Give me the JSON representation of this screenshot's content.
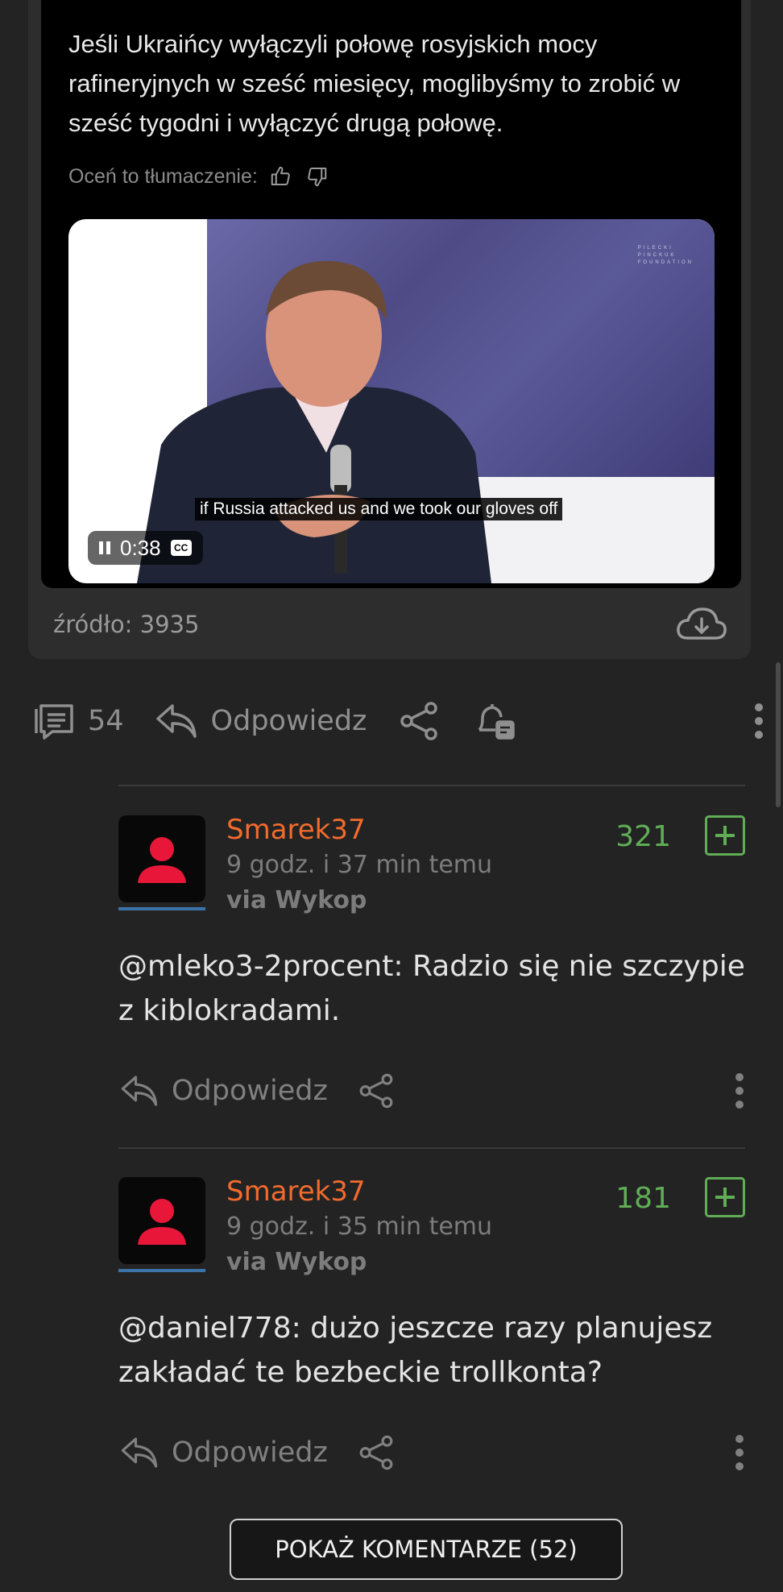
{
  "embed": {
    "tweet_text": "Jeśli Ukraińcy wyłączyli połowę rosyjskich mocy rafineryjnych w sześć miesięcy, moglibyśmy to zrobić w sześć tygodni i wyłączyć drugą połowę.",
    "rate_label": "Oceń to tłumaczenie:",
    "video": {
      "subtitle": "if Russia attacked us and we took our gloves off",
      "time": "0:38",
      "cc_label": "CC",
      "watermark": "PILECKI\nPINCKUK\nFOUNDATION"
    },
    "source_label": "źródło: 3935"
  },
  "post_actions": {
    "comments_count": "54",
    "reply_label": "Odpowiedz"
  },
  "comments": [
    {
      "nick": "Smarek37",
      "time": "9 godz. i 37 min temu",
      "via": "via Wykop",
      "score": "321",
      "text": "@mleko3-2procent: Radzio się nie szczypie z kiblokradami.",
      "reply_label": "Odpowiedz"
    },
    {
      "nick": "Smarek37",
      "time": "9 godz. i 35 min temu",
      "via": "via Wykop",
      "score": "181",
      "text": "@daniel778: dużo jeszcze razy planujesz zakładać te bezbeckie trollkonta?",
      "reply_label": "Odpowiedz"
    }
  ],
  "show_comments_label": "POKAŻ KOMENTARZE (52)",
  "colors": {
    "background": "#232323",
    "nick": "#f26b2c",
    "score": "#60ad56",
    "avatar_icon": "#e8173a",
    "avatar_underline": "#3c73a8"
  }
}
